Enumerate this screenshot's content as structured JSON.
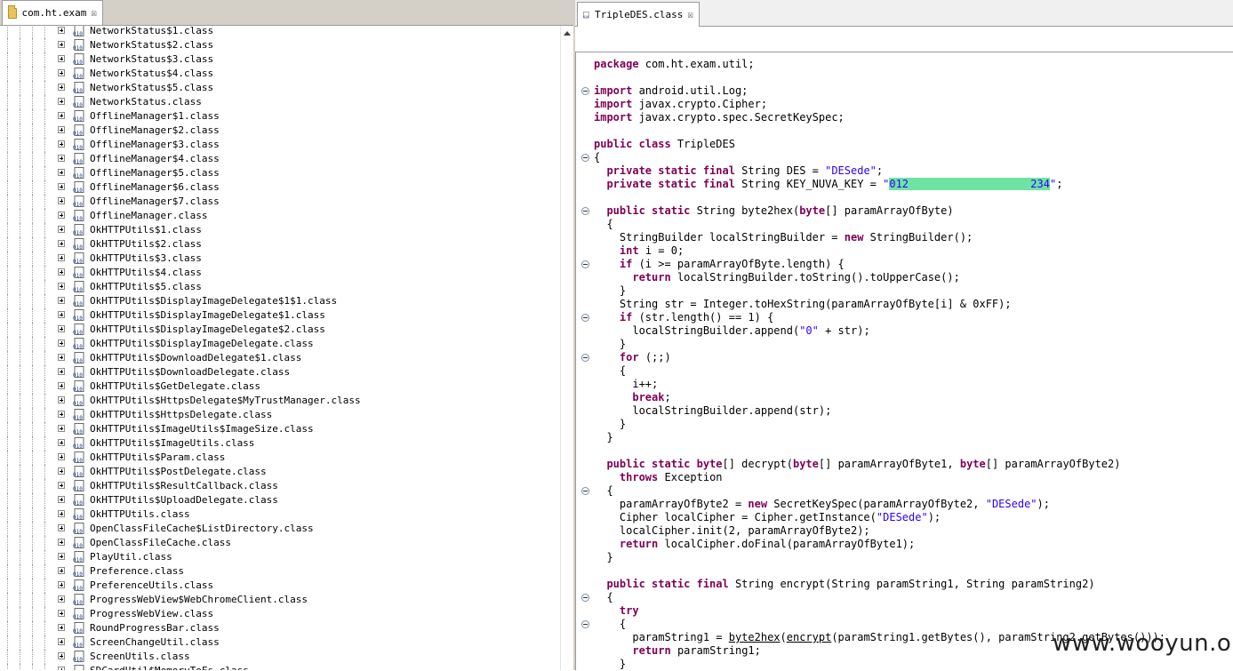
{
  "left_tab": {
    "label": "com.ht.exam",
    "close": "☒"
  },
  "right_tab": {
    "label": "TripleDES.class",
    "close": "☒"
  },
  "tree_items": [
    "NetworkStatus$1.class",
    "NetworkStatus$2.class",
    "NetworkStatus$3.class",
    "NetworkStatus$4.class",
    "NetworkStatus$5.class",
    "NetworkStatus.class",
    "OfflineManager$1.class",
    "OfflineManager$2.class",
    "OfflineManager$3.class",
    "OfflineManager$4.class",
    "OfflineManager$5.class",
    "OfflineManager$6.class",
    "OfflineManager$7.class",
    "OfflineManager.class",
    "OkHTTPUtils$1.class",
    "OkHTTPUtils$2.class",
    "OkHTTPUtils$3.class",
    "OkHTTPUtils$4.class",
    "OkHTTPUtils$5.class",
    "OkHTTPUtils$DisplayImageDelegate$1$1.class",
    "OkHTTPUtils$DisplayImageDelegate$1.class",
    "OkHTTPUtils$DisplayImageDelegate$2.class",
    "OkHTTPUtils$DisplayImageDelegate.class",
    "OkHTTPUtils$DownloadDelegate$1.class",
    "OkHTTPUtils$DownloadDelegate.class",
    "OkHTTPUtils$GetDelegate.class",
    "OkHTTPUtils$HttpsDelegate$MyTrustManager.class",
    "OkHTTPUtils$HttpsDelegate.class",
    "OkHTTPUtils$ImageUtils$ImageSize.class",
    "OkHTTPUtils$ImageUtils.class",
    "OkHTTPUtils$Param.class",
    "OkHTTPUtils$PostDelegate.class",
    "OkHTTPUtils$ResultCallback.class",
    "OkHTTPUtils$UploadDelegate.class",
    "OkHTTPUtils.class",
    "OpenClassFileCache$ListDirectory.class",
    "OpenClassFileCache.class",
    "PlayUtil.class",
    "Preference.class",
    "PreferenceUtils.class",
    "ProgressWebView$WebChromeClient.class",
    "ProgressWebView.class",
    "RoundProgressBar.class",
    "ScreenChangeUtil.class",
    "ScreenUtils.class",
    "SDCardUtil$MemoryToFs.class"
  ],
  "icon_text": "010",
  "code_lines": [
    [
      [
        "kw",
        "package"
      ],
      [
        "t",
        " com.ht.exam.util;"
      ]
    ],
    [],
    [
      [
        "kw",
        "import"
      ],
      [
        "t",
        " android.util.Log;"
      ]
    ],
    [
      [
        "kw",
        "import"
      ],
      [
        "t",
        " javax.crypto.Cipher;"
      ]
    ],
    [
      [
        "kw",
        "import"
      ],
      [
        "t",
        " javax.crypto.spec.SecretKeySpec;"
      ]
    ],
    [],
    [
      [
        "kw",
        "public class"
      ],
      [
        "t",
        " TripleDES"
      ]
    ],
    [
      [
        "t",
        "{"
      ]
    ],
    [
      [
        "t",
        "  "
      ],
      [
        "kw",
        "private static final"
      ],
      [
        "t",
        " String DES = "
      ],
      [
        "str",
        "\"DESede\""
      ],
      [
        "t",
        ";"
      ]
    ],
    [
      [
        "t",
        "  "
      ],
      [
        "kw",
        "private static final"
      ],
      [
        "t",
        " String KEY_NUVA_KEY = "
      ],
      [
        "str",
        "\""
      ],
      [
        "hl",
        "012                   234"
      ],
      [
        "str",
        "\""
      ],
      [
        "t",
        ";"
      ]
    ],
    [],
    [
      [
        "t",
        "  "
      ],
      [
        "kw",
        "public static"
      ],
      [
        "t",
        " String byte2hex("
      ],
      [
        "kw",
        "byte"
      ],
      [
        "t",
        "[] paramArrayOfByte)"
      ]
    ],
    [
      [
        "t",
        "  {"
      ]
    ],
    [
      [
        "t",
        "    StringBuilder localStringBuilder = "
      ],
      [
        "kw",
        "new"
      ],
      [
        "t",
        " StringBuilder();"
      ]
    ],
    [
      [
        "t",
        "    "
      ],
      [
        "kw",
        "int"
      ],
      [
        "t",
        " i = 0;"
      ]
    ],
    [
      [
        "t",
        "    "
      ],
      [
        "kw",
        "if"
      ],
      [
        "t",
        " (i >= paramArrayOfByte.length) {"
      ]
    ],
    [
      [
        "t",
        "      "
      ],
      [
        "kw",
        "return"
      ],
      [
        "t",
        " localStringBuilder.toString().toUpperCase();"
      ]
    ],
    [
      [
        "t",
        "    }"
      ]
    ],
    [
      [
        "t",
        "    String str = Integer.toHexString(paramArrayOfByte[i] & 0xFF);"
      ]
    ],
    [
      [
        "t",
        "    "
      ],
      [
        "kw",
        "if"
      ],
      [
        "t",
        " (str.length() == 1) {"
      ]
    ],
    [
      [
        "t",
        "      localStringBuilder.append("
      ],
      [
        "str",
        "\"0\""
      ],
      [
        "t",
        " + str);"
      ]
    ],
    [
      [
        "t",
        "    }"
      ]
    ],
    [
      [
        "t",
        "    "
      ],
      [
        "kw",
        "for"
      ],
      [
        "t",
        " (;;)"
      ]
    ],
    [
      [
        "t",
        "    {"
      ]
    ],
    [
      [
        "t",
        "      i++;"
      ]
    ],
    [
      [
        "t",
        "      "
      ],
      [
        "kw",
        "break"
      ],
      [
        "t",
        ";"
      ]
    ],
    [
      [
        "t",
        "      localStringBuilder.append(str);"
      ]
    ],
    [
      [
        "t",
        "    }"
      ]
    ],
    [
      [
        "t",
        "  }"
      ]
    ],
    [],
    [
      [
        "t",
        "  "
      ],
      [
        "kw",
        "public static byte"
      ],
      [
        "t",
        "[] decrypt("
      ],
      [
        "kw",
        "byte"
      ],
      [
        "t",
        "[] paramArrayOfByte1, "
      ],
      [
        "kw",
        "byte"
      ],
      [
        "t",
        "[] paramArrayOfByte2)"
      ]
    ],
    [
      [
        "t",
        "    "
      ],
      [
        "kw",
        "throws"
      ],
      [
        "t",
        " Exception"
      ]
    ],
    [
      [
        "t",
        "  {"
      ]
    ],
    [
      [
        "t",
        "    paramArrayOfByte2 = "
      ],
      [
        "kw",
        "new"
      ],
      [
        "t",
        " SecretKeySpec(paramArrayOfByte2, "
      ],
      [
        "str",
        "\"DESede\""
      ],
      [
        "t",
        ");"
      ]
    ],
    [
      [
        "t",
        "    Cipher localCipher = Cipher.getInstance("
      ],
      [
        "str",
        "\"DESede\""
      ],
      [
        "t",
        ");"
      ]
    ],
    [
      [
        "t",
        "    localCipher.init(2, paramArrayOfByte2);"
      ]
    ],
    [
      [
        "t",
        "    "
      ],
      [
        "kw",
        "return"
      ],
      [
        "t",
        " localCipher.doFinal(paramArrayOfByte1);"
      ]
    ],
    [
      [
        "t",
        "  }"
      ]
    ],
    [],
    [
      [
        "t",
        "  "
      ],
      [
        "kw",
        "public static final"
      ],
      [
        "t",
        " String encrypt(String paramString1, String paramString2)"
      ]
    ],
    [
      [
        "t",
        "  {"
      ]
    ],
    [
      [
        "t",
        "    "
      ],
      [
        "kw",
        "try"
      ]
    ],
    [
      [
        "t",
        "    {"
      ]
    ],
    [
      [
        "t",
        "      paramString1 = "
      ],
      [
        "ul",
        "byte2hex"
      ],
      [
        "t",
        "("
      ],
      [
        "ul",
        "encrypt"
      ],
      [
        "t",
        "(paramString1.getBytes(), paramString2.getBytes()));"
      ]
    ],
    [
      [
        "t",
        "      "
      ],
      [
        "kw",
        "return"
      ],
      [
        "t",
        " paramString1;"
      ]
    ],
    [
      [
        "t",
        "    }"
      ]
    ]
  ],
  "watermark": "www.wooyun.org"
}
